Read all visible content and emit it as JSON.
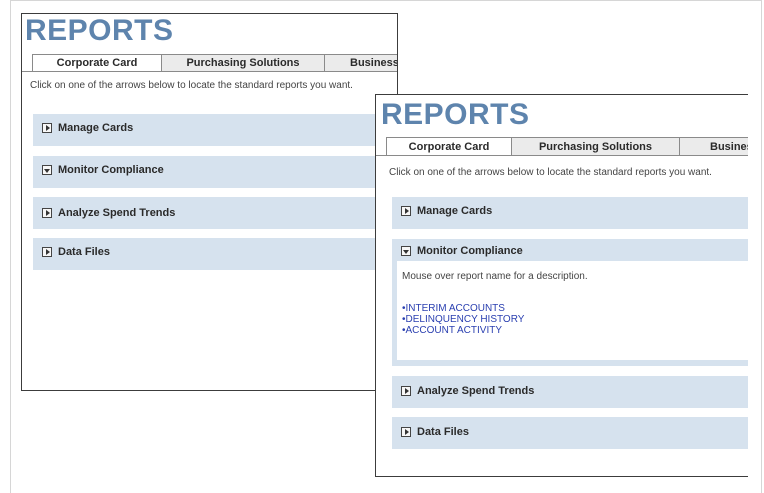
{
  "page_title": "REPORTS",
  "tabs": [
    "Corporate Card",
    "Purchasing Solutions",
    "Business"
  ],
  "instructions": "Click on one of the arrows below to locate the standard reports you want.",
  "sections": {
    "manage_cards": "Manage Cards",
    "monitor_compliance": "Monitor Compliance",
    "analyze_spend_trends": "Analyze Spend Trends",
    "data_files": "Data Files"
  },
  "compliance_panel": {
    "description": "Mouse over report name for a description.",
    "reports": [
      "•INTERIM ACCOUNTS",
      "•DELINQUENCY HISTORY",
      "•ACCOUNT ACTIVITY"
    ]
  },
  "colors": {
    "title": "#5e84ad",
    "section_bg": "#d6e2ee",
    "link": "#2a3fb0"
  }
}
